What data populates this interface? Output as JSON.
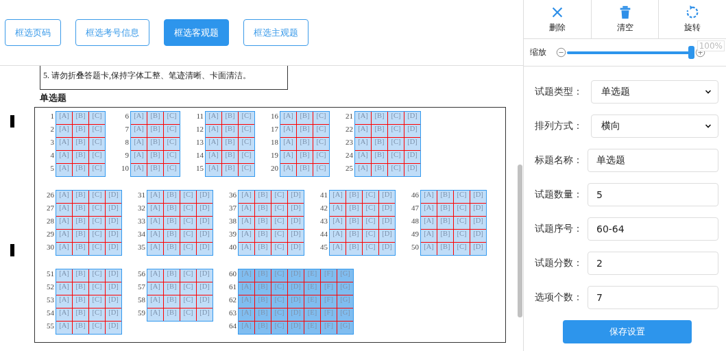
{
  "top_buttons": [
    {
      "label": "框选页码",
      "selected": false
    },
    {
      "label": "框选考号信息",
      "selected": false
    },
    {
      "label": "框选客观题",
      "selected": true
    },
    {
      "label": "框选主观题",
      "selected": false
    }
  ],
  "tools": [
    {
      "kind": "delete",
      "label": "删除"
    },
    {
      "kind": "clear",
      "label": "清空"
    },
    {
      "kind": "rotate",
      "label": "旋转"
    }
  ],
  "zoom": {
    "label": "缩放",
    "level": 1,
    "reading": "100%"
  },
  "sheet": {
    "notice_line": "5. 请勿折叠答题卡,保持字体工整、笔迹清晰、卡面清洁。",
    "section_title": "单选题",
    "blocks": [
      {
        "groups": [
          {
            "selected": false,
            "rows": [
              {
                "number": "1",
                "options": [
                  "[A]",
                  "[B]",
                  "[C]"
                ]
              },
              {
                "number": "2",
                "options": [
                  "[A]",
                  "[B]",
                  "[C]"
                ]
              },
              {
                "number": "3",
                "options": [
                  "[A]",
                  "[B]",
                  "[C]"
                ]
              },
              {
                "number": "4",
                "options": [
                  "[A]",
                  "[B]",
                  "[C]"
                ]
              },
              {
                "number": "5",
                "options": [
                  "[A]",
                  "[B]",
                  "[C]"
                ]
              }
            ]
          },
          {
            "selected": false,
            "rows": [
              {
                "number": "6",
                "options": [
                  "[A]",
                  "[B]",
                  "[C]"
                ]
              },
              {
                "number": "7",
                "options": [
                  "[A]",
                  "[B]",
                  "[C]"
                ]
              },
              {
                "number": "8",
                "options": [
                  "[A]",
                  "[B]",
                  "[C]"
                ]
              },
              {
                "number": "9",
                "options": [
                  "[A]",
                  "[B]",
                  "[C]"
                ]
              },
              {
                "number": "10",
                "options": [
                  "[A]",
                  "[B]",
                  "[C]"
                ]
              }
            ]
          },
          {
            "selected": false,
            "rows": [
              {
                "number": "11",
                "options": [
                  "[A]",
                  "[B]",
                  "[C]"
                ]
              },
              {
                "number": "12",
                "options": [
                  "[A]",
                  "[B]",
                  "[C]"
                ]
              },
              {
                "number": "13",
                "options": [
                  "[A]",
                  "[B]",
                  "[C]"
                ]
              },
              {
                "number": "14",
                "options": [
                  "[A]",
                  "[B]",
                  "[C]"
                ]
              },
              {
                "number": "15",
                "options": [
                  "[A]",
                  "[B]",
                  "[C]"
                ]
              }
            ]
          },
          {
            "selected": false,
            "rows": [
              {
                "number": "16",
                "options": [
                  "[A]",
                  "[B]",
                  "[C]"
                ]
              },
              {
                "number": "17",
                "options": [
                  "[A]",
                  "[B]",
                  "[C]"
                ]
              },
              {
                "number": "18",
                "options": [
                  "[A]",
                  "[B]",
                  "[C]"
                ]
              },
              {
                "number": "19",
                "options": [
                  "[A]",
                  "[B]",
                  "[C]"
                ]
              },
              {
                "number": "20",
                "options": [
                  "[A]",
                  "[B]",
                  "[C]"
                ]
              }
            ]
          },
          {
            "selected": false,
            "rows": [
              {
                "number": "21",
                "options": [
                  "[A]",
                  "[B]",
                  "[C]",
                  "[D]"
                ]
              },
              {
                "number": "22",
                "options": [
                  "[A]",
                  "[B]",
                  "[C]",
                  "[D]"
                ]
              },
              {
                "number": "23",
                "options": [
                  "[A]",
                  "[B]",
                  "[C]",
                  "[D]"
                ]
              },
              {
                "number": "24",
                "options": [
                  "[A]",
                  "[B]",
                  "[C]",
                  "[D]"
                ]
              },
              {
                "number": "25",
                "options": [
                  "[A]",
                  "[B]",
                  "[C]",
                  "[D]"
                ]
              }
            ]
          }
        ]
      },
      {
        "groups": [
          {
            "selected": false,
            "rows": [
              {
                "number": "26",
                "options": [
                  "[A]",
                  "[B]",
                  "[C]",
                  "[D]"
                ]
              },
              {
                "number": "27",
                "options": [
                  "[A]",
                  "[B]",
                  "[C]",
                  "[D]"
                ]
              },
              {
                "number": "28",
                "options": [
                  "[A]",
                  "[B]",
                  "[C]",
                  "[D]"
                ]
              },
              {
                "number": "29",
                "options": [
                  "[A]",
                  "[B]",
                  "[C]",
                  "[D]"
                ]
              },
              {
                "number": "30",
                "options": [
                  "[A]",
                  "[B]",
                  "[C]",
                  "[D]"
                ]
              }
            ]
          },
          {
            "selected": false,
            "rows": [
              {
                "number": "31",
                "options": [
                  "[A]",
                  "[B]",
                  "[C]",
                  "[D]"
                ]
              },
              {
                "number": "32",
                "options": [
                  "[A]",
                  "[B]",
                  "[C]",
                  "[D]"
                ]
              },
              {
                "number": "33",
                "options": [
                  "[A]",
                  "[B]",
                  "[C]",
                  "[D]"
                ]
              },
              {
                "number": "34",
                "options": [
                  "[A]",
                  "[B]",
                  "[C]",
                  "[D]"
                ]
              },
              {
                "number": "35",
                "options": [
                  "[A]",
                  "[B]",
                  "[C]",
                  "[D]"
                ]
              }
            ]
          },
          {
            "selected": false,
            "rows": [
              {
                "number": "36",
                "options": [
                  "[A]",
                  "[B]",
                  "[C]",
                  "[D]"
                ]
              },
              {
                "number": "37",
                "options": [
                  "[A]",
                  "[B]",
                  "[C]",
                  "[D]"
                ]
              },
              {
                "number": "38",
                "options": [
                  "[A]",
                  "[B]",
                  "[C]",
                  "[D]"
                ]
              },
              {
                "number": "39",
                "options": [
                  "[A]",
                  "[B]",
                  "[C]",
                  "[D]"
                ]
              },
              {
                "number": "40",
                "options": [
                  "[A]",
                  "[B]",
                  "[C]",
                  "[D]"
                ]
              }
            ]
          },
          {
            "selected": false,
            "rows": [
              {
                "number": "41",
                "options": [
                  "[A]",
                  "[B]",
                  "[C]",
                  "[D]"
                ]
              },
              {
                "number": "42",
                "options": [
                  "[A]",
                  "[B]",
                  "[C]",
                  "[D]"
                ]
              },
              {
                "number": "43",
                "options": [
                  "[A]",
                  "[B]",
                  "[C]",
                  "[D]"
                ]
              },
              {
                "number": "44",
                "options": [
                  "[A]",
                  "[B]",
                  "[C]",
                  "[D]"
                ]
              },
              {
                "number": "45",
                "options": [
                  "[A]",
                  "[B]",
                  "[C]",
                  "[D]"
                ]
              }
            ]
          },
          {
            "selected": false,
            "rows": [
              {
                "number": "46",
                "options": [
                  "[A]",
                  "[B]",
                  "[C]",
                  "[D]"
                ]
              },
              {
                "number": "47",
                "options": [
                  "[A]",
                  "[B]",
                  "[C]",
                  "[D]"
                ]
              },
              {
                "number": "48",
                "options": [
                  "[A]",
                  "[B]",
                  "[C]",
                  "[D]"
                ]
              },
              {
                "number": "49",
                "options": [
                  "[A]",
                  "[B]",
                  "[C]",
                  "[D]"
                ]
              },
              {
                "number": "50",
                "options": [
                  "[A]",
                  "[B]",
                  "[C]",
                  "[D]"
                ]
              }
            ]
          }
        ]
      },
      {
        "groups": [
          {
            "selected": false,
            "rows": [
              {
                "number": "51",
                "options": [
                  "[A]",
                  "[B]",
                  "[C]",
                  "[D]"
                ]
              },
              {
                "number": "52",
                "options": [
                  "[A]",
                  "[B]",
                  "[C]",
                  "[D]"
                ]
              },
              {
                "number": "53",
                "options": [
                  "[A]",
                  "[B]",
                  "[C]",
                  "[D]"
                ]
              },
              {
                "number": "54",
                "options": [
                  "[A]",
                  "[B]",
                  "[C]",
                  "[D]"
                ]
              },
              {
                "number": "55",
                "options": [
                  "[A]",
                  "[B]",
                  "[C]",
                  "[D]"
                ]
              }
            ]
          },
          {
            "selected": false,
            "rows": [
              {
                "number": "56",
                "options": [
                  "[A]",
                  "[B]",
                  "[C]",
                  "[D]"
                ]
              },
              {
                "number": "57",
                "options": [
                  "[A]",
                  "[B]",
                  "[C]",
                  "[D]"
                ]
              },
              {
                "number": "58",
                "options": [
                  "[A]",
                  "[B]",
                  "[C]",
                  "[D]"
                ]
              },
              {
                "number": "59",
                "options": [
                  "[A]",
                  "[B]",
                  "[C]",
                  "[D]"
                ]
              }
            ]
          },
          {
            "selected": true,
            "rows": [
              {
                "number": "60",
                "options": [
                  "[A]",
                  "[B]",
                  "[C]",
                  "[D]",
                  "[E]",
                  "[F]",
                  "[G]"
                ]
              },
              {
                "number": "61",
                "options": [
                  "[A]",
                  "[B]",
                  "[C]",
                  "[D]",
                  "[E]",
                  "[F]",
                  "[G]"
                ]
              },
              {
                "number": "62",
                "options": [
                  "[A]",
                  "[B]",
                  "[C]",
                  "[D]",
                  "[E]",
                  "[F]",
                  "[G]"
                ]
              },
              {
                "number": "63",
                "options": [
                  "[A]",
                  "[B]",
                  "[C]",
                  "[D]",
                  "[E]",
                  "[F]",
                  "[G]"
                ]
              },
              {
                "number": "64",
                "options": [
                  "[A]",
                  "[B]",
                  "[C]",
                  "[D]",
                  "[E]",
                  "[F]",
                  "[G]"
                ]
              }
            ]
          }
        ]
      }
    ]
  },
  "settings": {
    "fields": [
      {
        "kind": "select",
        "label": "试题类型：",
        "value": "单选题"
      },
      {
        "kind": "select",
        "label": "排列方式：",
        "value": "横向"
      },
      {
        "kind": "input",
        "label": "标题名称：",
        "value": "单选题"
      },
      {
        "kind": "input",
        "label": "试题数量：",
        "value": "5"
      },
      {
        "kind": "input",
        "label": "试题序号：",
        "value": "60-64"
      },
      {
        "kind": "input",
        "label": "试题分数：",
        "value": "2"
      },
      {
        "kind": "input",
        "label": "选项个数：",
        "value": "7"
      }
    ],
    "save_button": "保存设置"
  }
}
